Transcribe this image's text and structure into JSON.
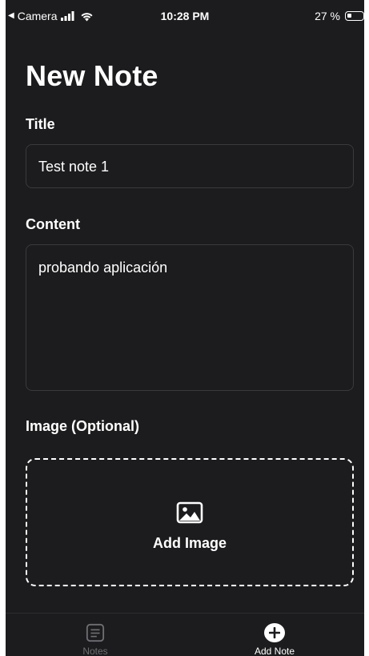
{
  "status_bar": {
    "back_app": "Camera",
    "time": "10:28 PM",
    "battery_percent": "27 %",
    "battery_level": 0.27
  },
  "page": {
    "title": "New Note"
  },
  "form": {
    "title_label": "Title",
    "title_value": "Test note 1",
    "content_label": "Content",
    "content_value": "probando aplicación",
    "image_label": "Image (Optional)",
    "add_image_label": "Add Image",
    "add_image_icon": "photo-icon"
  },
  "tab_bar": {
    "tabs": [
      {
        "label": "Notes",
        "icon": "notes-icon",
        "active": false
      },
      {
        "label": "Add Note",
        "icon": "plus-circle-icon",
        "active": true
      }
    ]
  },
  "colors": {
    "background": "#1c1c1e",
    "text": "#ffffff",
    "input_border": "#3a3a3c",
    "inactive_tab": "#6e6e73"
  }
}
